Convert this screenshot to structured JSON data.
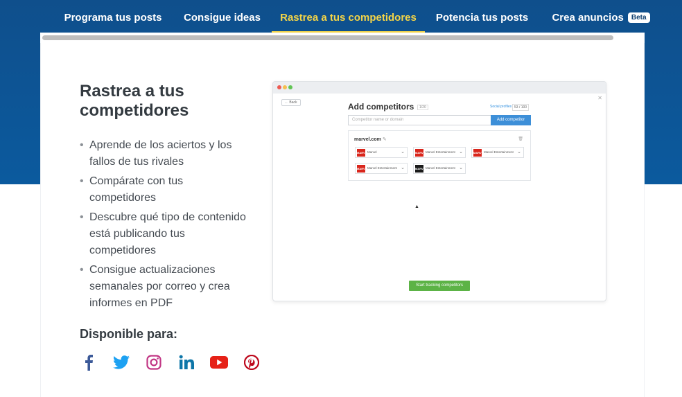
{
  "tabs": [
    {
      "label": "Programa tus posts"
    },
    {
      "label": "Consigue ideas"
    },
    {
      "label": "Rastrea a tus competidores"
    },
    {
      "label": "Potencia tus posts"
    },
    {
      "label": "Crea anuncios",
      "badge": "Beta"
    }
  ],
  "active_tab": "Rastrea a tus competidores",
  "colors": {
    "header_blue": "#0b5a9e",
    "active_tab": "#f5d547",
    "start_button": "#5cb346",
    "add_button": "#3d8fd8"
  },
  "feature": {
    "title": "Rastrea a tus competidores",
    "bullets": [
      "Aprende de los aciertos y los fallos de tus rivales",
      "Compárate con tus competidores",
      "Descubre qué tipo de contenido está publicando tus competidores",
      "Consigue actualizaciones semanales por correo y crea informes en PDF"
    ],
    "available_label": "Disponible para:",
    "networks": [
      {
        "name": "facebook",
        "icon": "facebook-icon",
        "color": "#3b5998"
      },
      {
        "name": "twitter",
        "icon": "twitter-icon",
        "color": "#1da1f2"
      },
      {
        "name": "instagram",
        "icon": "instagram-icon",
        "color": "#c13584"
      },
      {
        "name": "linkedin",
        "icon": "linkedin-icon",
        "color": "#0e76a8"
      },
      {
        "name": "youtube",
        "icon": "youtube-icon",
        "color": "#e62117"
      },
      {
        "name": "pinterest",
        "icon": "pinterest-icon",
        "color": "#bd081c"
      }
    ]
  },
  "mockup": {
    "back_label": "← Back",
    "heading": "Add competitors",
    "count": "1/20",
    "social_profiles_label": "Social profiles",
    "social_profiles_value": "53 / 100",
    "input_placeholder": "Competitor name or domain",
    "add_button": "Add competitor",
    "domain": "marvel.com",
    "profiles": [
      {
        "name": "Marvel",
        "logo": "MARVEL"
      },
      {
        "name": "Marvel Entertainment",
        "logo": "MARVEL"
      },
      {
        "name": "Marvel Entertainment",
        "logo": "MARVEL"
      },
      {
        "name": "Marvel Entertainment",
        "logo": "MARVEL"
      },
      {
        "name": "Marvel Entertainment",
        "logo": "MARVEL"
      }
    ],
    "start_button": "Start tracking competitors"
  }
}
